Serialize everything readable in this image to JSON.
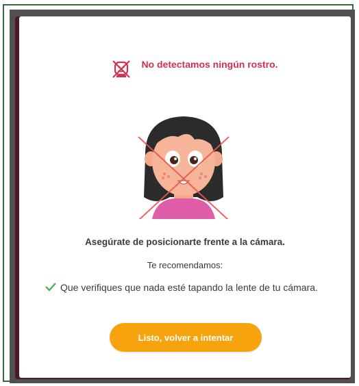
{
  "modal": {
    "error_message": "No detectamos ningún rostro.",
    "instruction": "Asegúrate de posicionarte frente a la cámara.",
    "recommendation_heading": "Te recomendamos:",
    "tips": [
      "Que verifiques que nada esté tapando la lente de tu cámara."
    ],
    "retry_button_label": "Listo, volver a intentar"
  },
  "icons": {
    "error": "crossed-face-icon",
    "check": "checkmark-icon",
    "illustration": "crossed-out-girl-face"
  },
  "colors": {
    "error": "#d2304f",
    "accent_button": "#f7a30d",
    "check": "#4caf50",
    "frame_green": "#2f6b3c",
    "frame_gray": "#505050",
    "backdrop": "#4a1a26"
  }
}
